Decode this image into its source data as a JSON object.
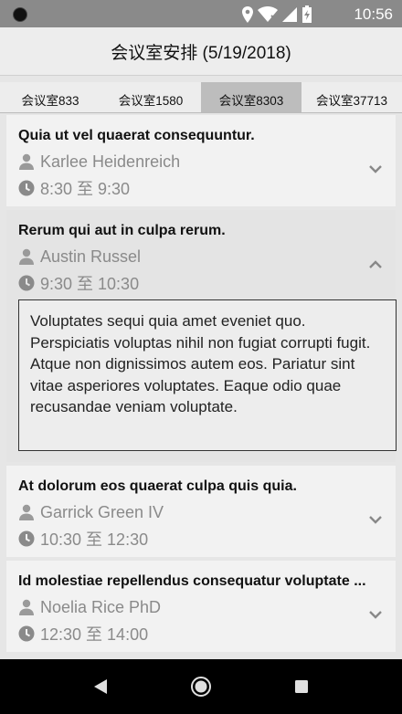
{
  "status": {
    "time": "10:56"
  },
  "header": {
    "title": "会议室安排 (5/19/2018)"
  },
  "tabs": [
    {
      "label": "会议室833",
      "active": false
    },
    {
      "label": "会议室1580",
      "active": false
    },
    {
      "label": "会议室8303",
      "active": true
    },
    {
      "label": "会议室37713",
      "active": false
    }
  ],
  "meetings": [
    {
      "title": "Quia ut vel quaerat consequuntur.",
      "host": "Karlee Heidenreich",
      "time": "8:30 至 9:30",
      "expanded": false
    },
    {
      "title": "Rerum qui aut in culpa rerum.",
      "host": "Austin Russel",
      "time": "9:30 至 10:30",
      "expanded": true,
      "description": "Voluptates sequi quia amet eveniet quo. Perspiciatis voluptas nihil non fugiat corrupti fugit. Atque non dignissimos autem eos. Pariatur sint vitae asperiores voluptates. Eaque odio quae recusandae veniam voluptate."
    },
    {
      "title": "At dolorum eos quaerat culpa quis quia.",
      "host": "Garrick Green IV",
      "time": "10:30 至 12:30",
      "expanded": false
    },
    {
      "title": "Id molestiae repellendus consequatur voluptate ...",
      "host": "Noelia Rice PhD",
      "time": "12:30 至 14:00",
      "expanded": false
    }
  ],
  "icons": {
    "host": "person-icon",
    "time": "clock-icon",
    "collapse": "chevron-up-icon",
    "expand": "chevron-down-icon"
  }
}
